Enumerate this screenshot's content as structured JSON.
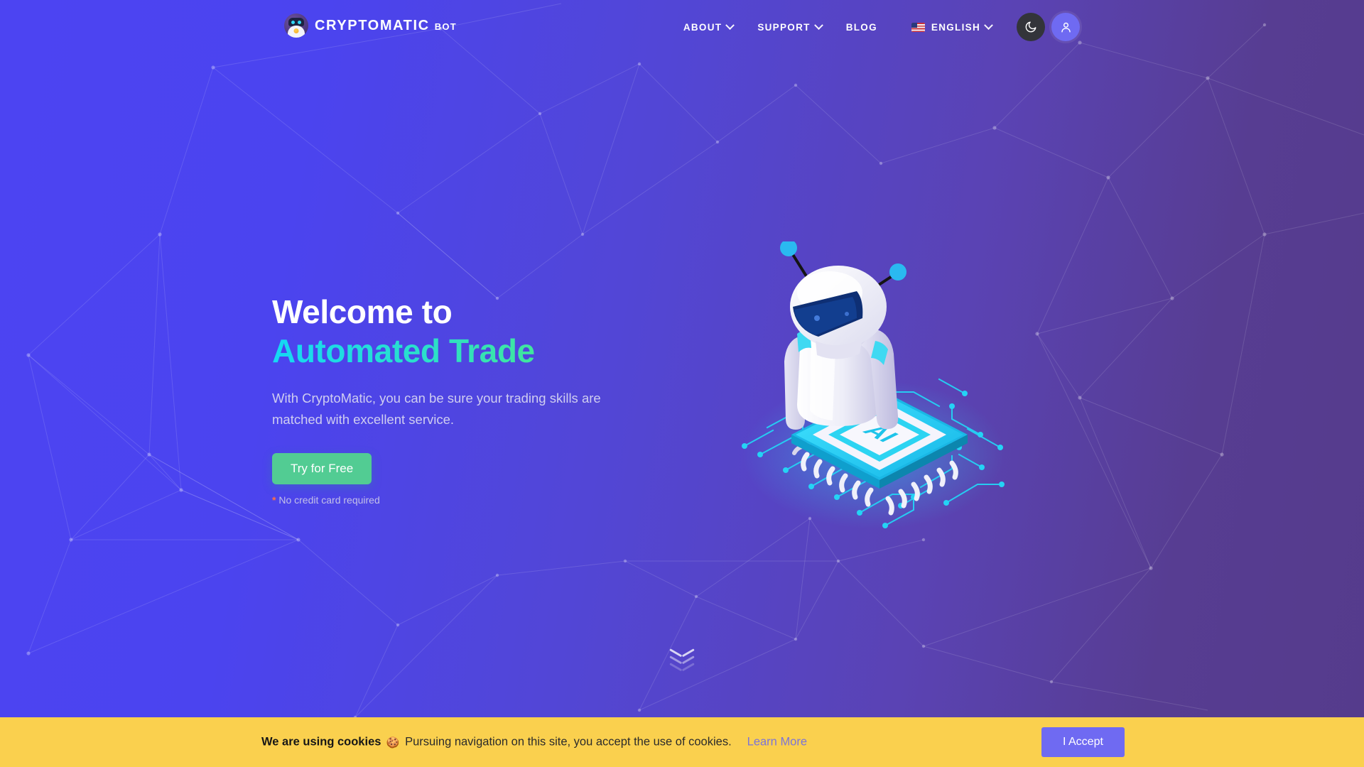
{
  "brand": {
    "name": "CRYPTOMATIC",
    "suffix": "BOT",
    "logo_icon": "robot-avatar-icon"
  },
  "nav": {
    "items": [
      {
        "label": "ABOUT",
        "has_dropdown": true,
        "icon": "chevron-down-icon"
      },
      {
        "label": "SUPPORT",
        "has_dropdown": true,
        "icon": "chevron-down-icon"
      },
      {
        "label": "BLOG",
        "has_dropdown": false,
        "icon": ""
      }
    ],
    "language": {
      "label": "ENGLISH",
      "flag_icon": "us-flag-icon",
      "caret_icon": "chevron-down-icon"
    },
    "theme_toggle": {
      "icon": "moon-icon",
      "bg": "#33343a"
    },
    "account": {
      "icon": "user-icon",
      "bg": "#6f6af2"
    }
  },
  "hero": {
    "title_line1": "Welcome to",
    "title_line2": "Automated Trade",
    "subtitle": "With CryptoMatic, you can be sure your trading skills are matched with excellent service.",
    "cta_label": "Try for Free",
    "note_star": "*",
    "note_text": "No credit card required",
    "illustration": "robot-on-ai-chip-illustration",
    "chip_label": "AI"
  },
  "scroll_cue": {
    "icon": "chevron-down-icon",
    "count": 3
  },
  "cookie_banner": {
    "strong_text": "We are using cookies",
    "emoji": "🍪",
    "message": "Pursuing navigation on this site, you accept the use of cookies.",
    "learn_more_label": "Learn More",
    "accept_label": "I Accept"
  },
  "colors": {
    "bg_left": "#4c44f2",
    "bg_right": "#553b8c",
    "accent_green": "#52cc93",
    "gradient_start": "#15d8f5",
    "gradient_end": "#5ceb6e",
    "cookie_yellow": "#fad04e",
    "link_periwinkle": "#7b74d8",
    "accent_purple": "#6f6af2",
    "star_orange": "#ff7043"
  }
}
